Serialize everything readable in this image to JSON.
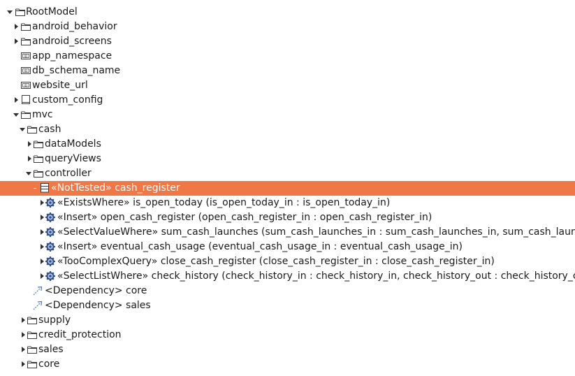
{
  "tree": {
    "root": "RootModel",
    "android_behavior": "android_behavior",
    "android_screens": "android_screens",
    "app_namespace": "app_namespace",
    "db_schema_name": "db_schema_name",
    "website_url": "website_url",
    "custom_config": "custom_config",
    "mvc": "mvc",
    "cash": "cash",
    "dataModels": "dataModels",
    "queryViews": "queryViews",
    "controller": "controller",
    "cash_register": {
      "stereotype": "«NotTested»",
      "name": "cash_register"
    },
    "methods": [
      {
        "stereotype": "«ExistsWhere»",
        "sig": "is_open_today (is_open_today_in : is_open_today_in)"
      },
      {
        "stereotype": "«Insert»",
        "sig": "open_cash_register (open_cash_register_in : open_cash_register_in)"
      },
      {
        "stereotype": "«SelectValueWhere»",
        "sig": "sum_cash_launches (sum_cash_launches_in : sum_cash_launches_in, sum_cash_launche"
      },
      {
        "stereotype": "«Insert»",
        "sig": "eventual_cash_usage (eventual_cash_usage_in : eventual_cash_usage_in)"
      },
      {
        "stereotype": "«TooComplexQuery»",
        "sig": "close_cash_register (close_cash_register_in : close_cash_register_in)"
      },
      {
        "stereotype": "«SelectListWhere»",
        "sig": "check_history (check_history_in : check_history_in, check_history_out : check_history_out)"
      }
    ],
    "dependencies": [
      "<Dependency> core",
      "<Dependency> sales"
    ],
    "supply": "supply",
    "credit_protection": "credit_protection",
    "sales": "sales",
    "core": "core"
  },
  "colors": {
    "selection": "#f07746",
    "folder_stroke": "#3a3a3a",
    "gear": "#2f4f8a",
    "dependency": "#4a7ab8"
  },
  "icons": {
    "folder": "folder-icon",
    "attribute": "attribute-icon",
    "config": "config-icon",
    "class": "class-icon",
    "method": "gear-icon",
    "dependency": "dependency-icon"
  }
}
